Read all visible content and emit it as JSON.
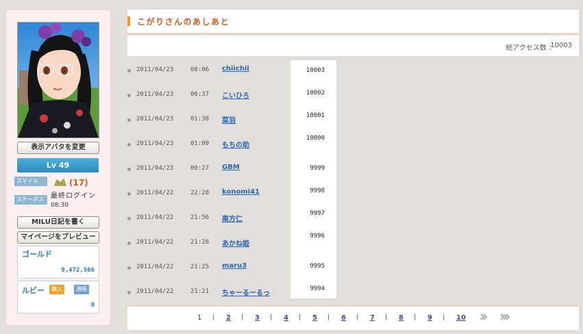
{
  "profile": {
    "change_avatar_label": "表示アバタを変更",
    "level": "Lv 49",
    "smile_label": "スマイル",
    "smile_count": "(17)",
    "status_label": "ステータス",
    "last_login_label": "最終ログイン",
    "last_login_time": "08:30",
    "diary_button": "MILU日記を書く",
    "preview_button": "マイページをプレビュー",
    "gold_label": "ゴールド",
    "gold_value": "9,472,566",
    "ruby_label": "ルビー",
    "ruby_buy": "購入",
    "ruby_history": "通帳",
    "ruby_value": "0"
  },
  "main": {
    "title": "こがりさんのあしあと",
    "access_label": "総アクセス数 ：",
    "access_count": "10003"
  },
  "visits": [
    {
      "date": "2011/04/23",
      "time": "08:06",
      "name": "chiichii",
      "count": "10003"
    },
    {
      "date": "2011/04/23",
      "time": "06:37",
      "name": "こいひろ",
      "count": "10002"
    },
    {
      "date": "2011/04/23",
      "time": "01:38",
      "name": "菜羽",
      "count": "10001"
    },
    {
      "date": "2011/04/23",
      "time": "01:00",
      "name": "もちの助",
      "count": "10000"
    },
    {
      "date": "2011/04/23",
      "time": "00:27",
      "name": "GBM",
      "count": "9999"
    },
    {
      "date": "2011/04/22",
      "time": "22:28",
      "name": "konomi41",
      "count": "9998"
    },
    {
      "date": "2011/04/22",
      "time": "21:56",
      "name": "南方仁",
      "count": "9997"
    },
    {
      "date": "2011/04/22",
      "time": "21:28",
      "name": "あかね姫",
      "count": "9996"
    },
    {
      "date": "2011/04/22",
      "time": "21:25",
      "name": "maru3",
      "count": "9995"
    },
    {
      "date": "2011/04/22",
      "time": "21:21",
      "name": "ちゃーるーるっ",
      "count": "9994"
    }
  ],
  "pagination": {
    "current": "1",
    "pages": [
      "2",
      "3",
      "4",
      "5",
      "6",
      "7",
      "8",
      "9",
      "10"
    ],
    "separator": "|",
    "next": "≫",
    "last": "≫"
  }
}
